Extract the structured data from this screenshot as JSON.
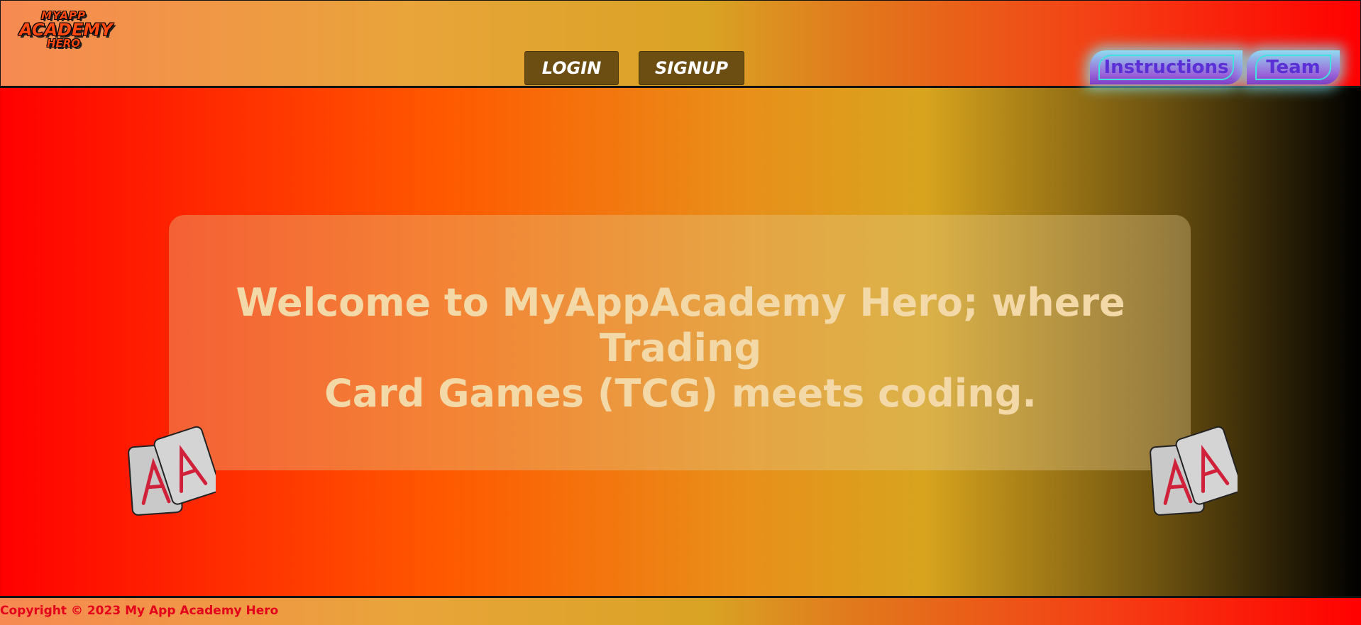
{
  "header": {
    "logo": {
      "line1": "MYAPP",
      "line2": "ACADEMY",
      "line3": "HERO"
    },
    "nav": {
      "login_label": "LOGIN",
      "signup_label": "SIGNUP"
    },
    "menu": {
      "instructions_label": "Instructions",
      "team_label": "Team"
    }
  },
  "hero": {
    "line1": "Welcome to MyAppAcademy Hero; where Trading",
    "line2": "Card Games (TCG) meets coding."
  },
  "icons": {
    "cards": "playing-cards-icon"
  },
  "footer": {
    "copyright": "Copyright © 2023 My App Academy Hero"
  },
  "colors": {
    "nav_button": "#6c4d12",
    "hero_text": "#f2d9a7",
    "copyright_text": "#e4001a",
    "menu_text": "#5b2fd6",
    "menu_glow": "#78f0ff"
  }
}
